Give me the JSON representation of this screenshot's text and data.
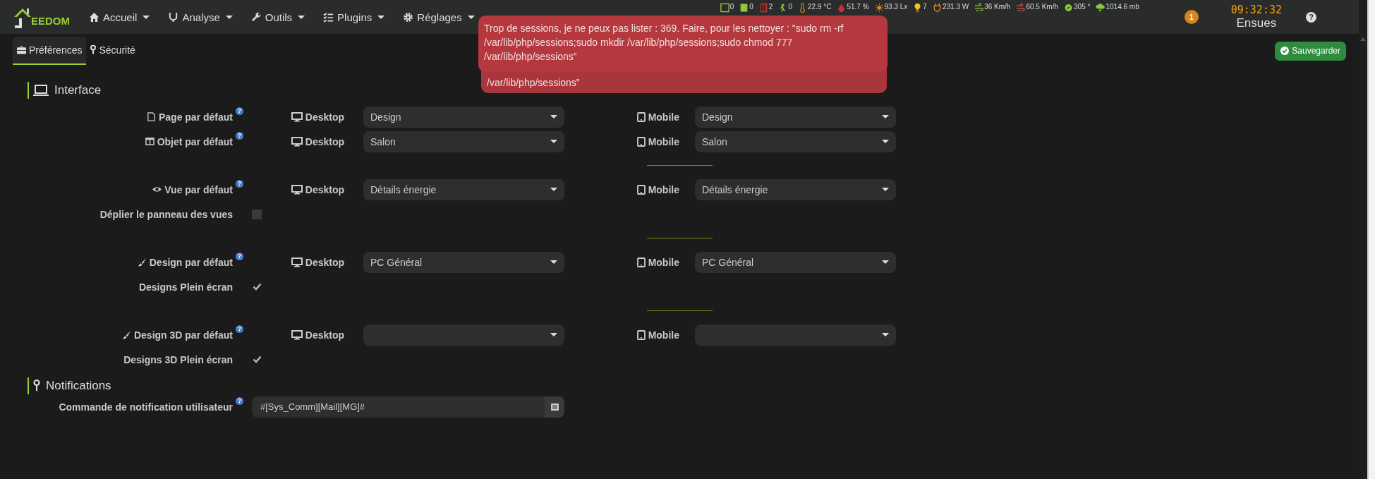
{
  "navbar": {
    "logo": "EEDOM",
    "menus": [
      {
        "label": "Accueil"
      },
      {
        "label": "Analyse"
      },
      {
        "label": "Outils"
      },
      {
        "label": "Plugins"
      },
      {
        "label": "Réglages"
      }
    ]
  },
  "status_widgets": [
    {
      "value": "0"
    },
    {
      "value": "0"
    },
    {
      "value": "2"
    },
    {
      "value": "0"
    },
    {
      "value": "22.9 °C"
    },
    {
      "value": "51.7 %"
    },
    {
      "value": "93.3 Lx"
    },
    {
      "value": "7"
    },
    {
      "value": "231.3 W"
    },
    {
      "value": "36 Km/h"
    },
    {
      "value": "60.5 Km/h"
    },
    {
      "value": "305 °"
    },
    {
      "value": "1014.6 mb"
    }
  ],
  "notification_badge": "1",
  "clock": {
    "time": "09:32:32",
    "location": "Ensues"
  },
  "help": "?",
  "toasts": [
    {
      "text": "Trop de sessions, je ne peux pas lister : 369. Faire, pour les nettoyer : \"sudo rm -rf /var/lib/php/sessions;sudo mkdir /var/lib/php/sessions;sudo chmod 777 /var/lib/php/sessions”"
    },
    {
      "text": "/var/lib/php/sessions”"
    }
  ],
  "tabs": [
    {
      "label": "Préférences",
      "selected": true
    },
    {
      "label": "Sécurité",
      "selected": false
    }
  ],
  "save_button": "Sauvegarder",
  "sections": [
    {
      "title": "Interface",
      "rows": [
        {
          "kind": "select-pair",
          "label": "Page par défaut",
          "help": "?",
          "desktop": {
            "label": "Desktop",
            "value": "Design"
          },
          "mobile": {
            "label": "Mobile",
            "value": "Design"
          }
        },
        {
          "kind": "select-pair",
          "label": "Objet par défaut",
          "help": "?",
          "desktop": {
            "label": "Desktop",
            "value": "Salon"
          },
          "mobile": {
            "label": "Mobile",
            "value": "Salon"
          }
        },
        {
          "kind": "separator"
        },
        {
          "kind": "select-pair",
          "label": "Vue par défaut",
          "help": "?",
          "desktop": {
            "label": "Desktop",
            "value": "Détails énergie"
          },
          "mobile": {
            "label": "Mobile",
            "value": "Détails énergie"
          }
        },
        {
          "kind": "checkbox",
          "label": "Déplier le panneau des vues",
          "checked": false
        },
        {
          "kind": "separator"
        },
        {
          "kind": "select-pair",
          "label": "Design par défaut",
          "help": "?",
          "desktop": {
            "label": "Desktop",
            "value": "PC Général"
          },
          "mobile": {
            "label": "Mobile",
            "value": "PC Général"
          }
        },
        {
          "kind": "checkbox",
          "label": "Designs Plein écran",
          "checked": true
        },
        {
          "kind": "separator"
        },
        {
          "kind": "select-pair",
          "label": "Design 3D par défaut",
          "help": "?",
          "desktop": {
            "label": "Desktop"
          },
          "mobile": {
            "label": "Mobile"
          }
        },
        {
          "kind": "checkbox",
          "label": "Designs 3D Plein écran",
          "checked": true
        }
      ]
    },
    {
      "title": "Notifications",
      "rows": [
        {
          "kind": "command",
          "label": "Commande de notification utilisateur",
          "help": "?",
          "value": "#[Sys_Comm][Mail][MG]#"
        }
      ]
    }
  ]
}
